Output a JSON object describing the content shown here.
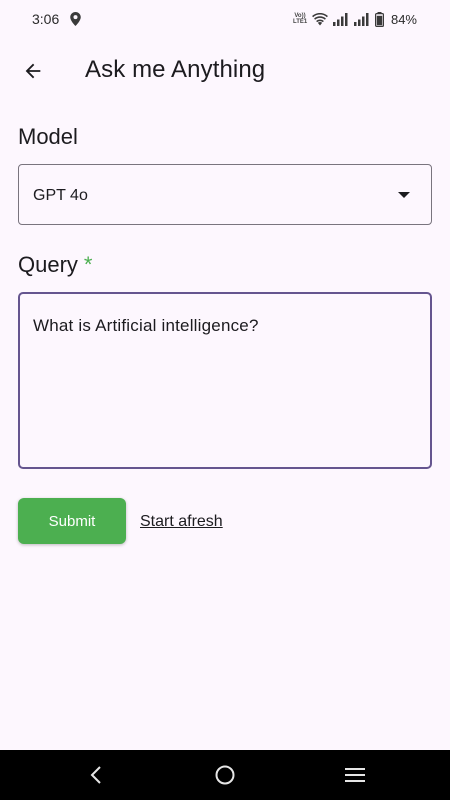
{
  "status_bar": {
    "time": "3:06",
    "volte_top": "Vo))",
    "volte_bottom": "LTE1",
    "battery": "84%"
  },
  "app_bar": {
    "title": "Ask me Anything",
    "back_icon": "arrow-back-icon"
  },
  "form": {
    "model_label": "Model",
    "model_value": "GPT 4o",
    "query_label": "Query",
    "required_marker": "*",
    "query_value": "What is Artificial intelligence?",
    "submit_label": "Submit",
    "reset_label": "Start afresh"
  },
  "colors": {
    "background": "#fdf7fe",
    "accent_green": "#4caf50",
    "focus_border": "#65558f"
  },
  "nav_bar": {
    "icons": [
      "back-icon",
      "home-icon",
      "recents-icon"
    ]
  }
}
